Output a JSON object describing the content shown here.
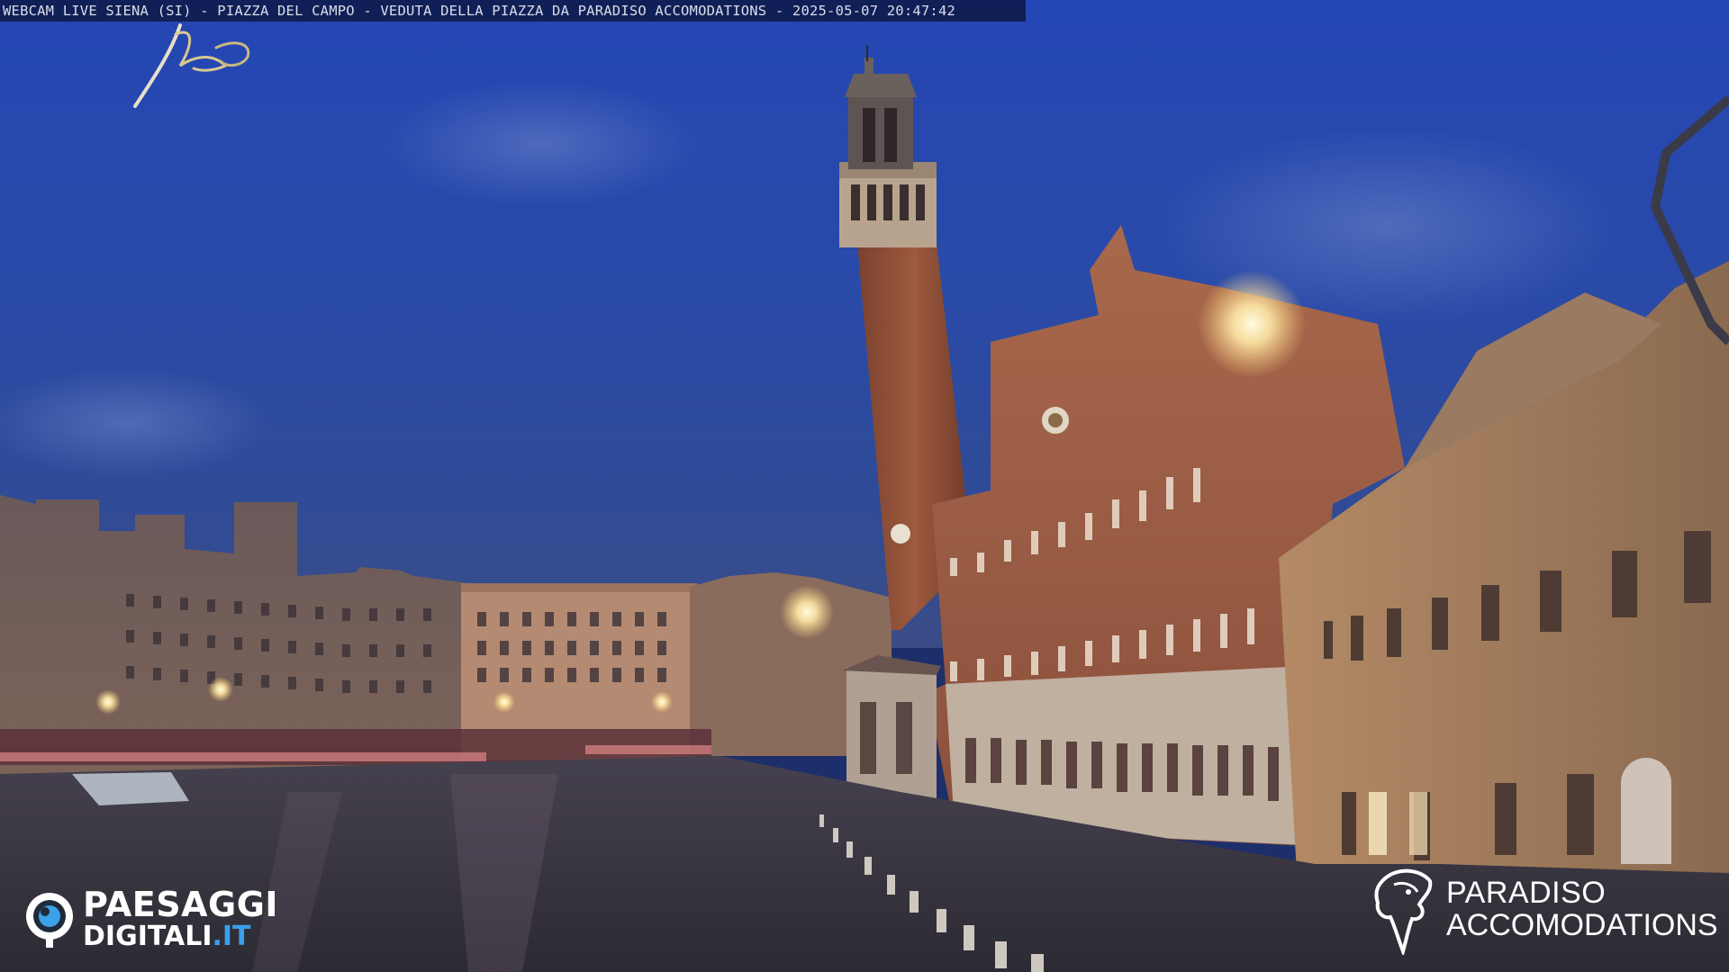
{
  "overlay": {
    "caption": "WEBCAM LIVE SIENA (SI) - PIAZZA DEL CAMPO - VEDUTA DELLA PIAZZA DA PARADISO ACCOMODATIONS - 2025-05-07 20:47:42"
  },
  "watermark_left": {
    "brand_line1": "PAESAGGI",
    "brand_line2_main": "DIGITALI",
    "brand_line2_suffix": ".IT",
    "accent_color": "#3aa0e8"
  },
  "watermark_right": {
    "brand_line1": "PARADISO",
    "brand_line2": "ACCOMODATIONS"
  },
  "scene": {
    "sky_color": "#2a48a8",
    "tower_color": "#9a5a3a",
    "palace_color": "#a8644a",
    "pavement_color": "#3a3a48"
  }
}
